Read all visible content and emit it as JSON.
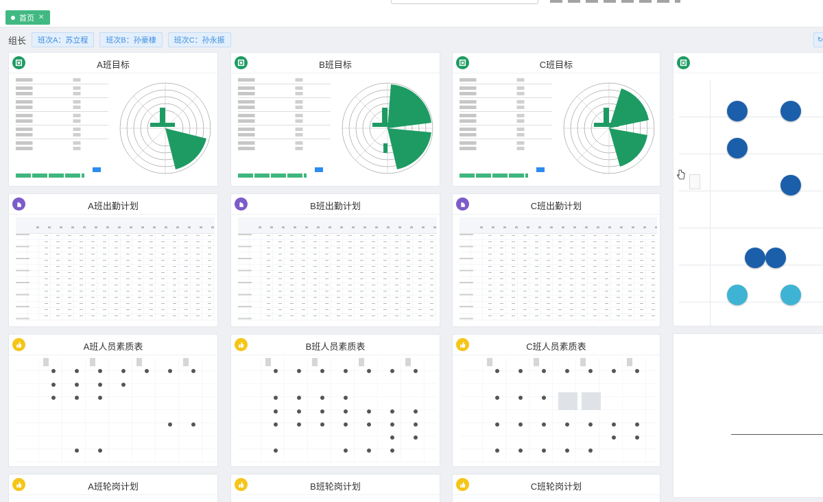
{
  "tabs": [
    {
      "label": "首页"
    }
  ],
  "leader_bar": {
    "label": "组长",
    "shifts": [
      "班次A：苏立程",
      "班次B：孙豪棣",
      "班次C：孙永振"
    ]
  },
  "cards": {
    "targets": [
      "A班目标",
      "B班目标",
      "C班目标"
    ],
    "attendance": [
      "A班出勤计划",
      "B班出勤计划",
      "C班出勤计划"
    ],
    "quality": [
      "A班人员素质表",
      "B班人员素质表",
      "C班人员素质表"
    ],
    "rotation": [
      "A班轮岗计划",
      "B班轮岗计划",
      "C班轮岗计划"
    ]
  },
  "colors": {
    "accent_green": "#42b983",
    "chart_green": "#1e9b63",
    "org_blue": "#1b5fab",
    "org_light": "#3fb3d4",
    "shift_blue": "#3c8dde"
  },
  "icons": {
    "target": "target-icon",
    "attendance": "hand-icon",
    "quality": "thumb-icon",
    "rotation": "thumb-icon"
  }
}
